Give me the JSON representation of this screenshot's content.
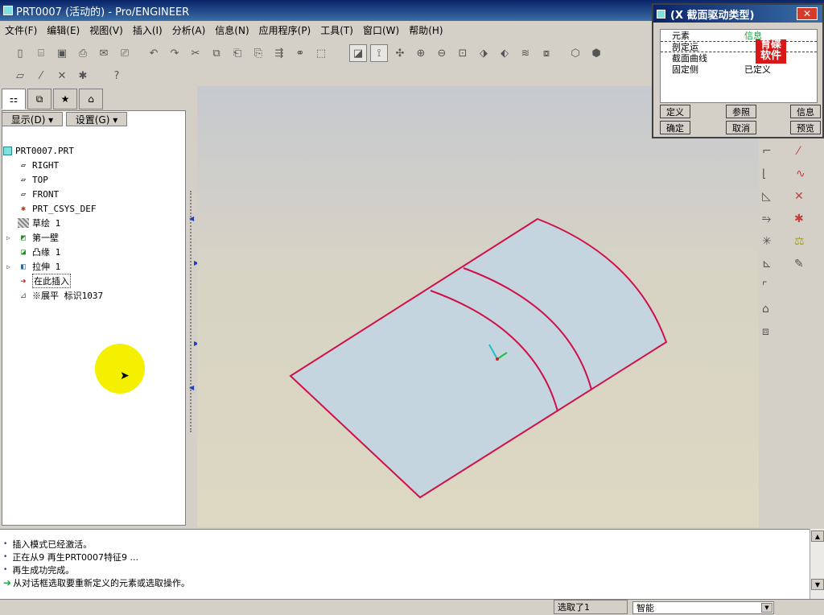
{
  "window": {
    "title": "PRT0007 (活动的) - Pro/ENGINEER"
  },
  "menu": [
    "文件(F)",
    "编辑(E)",
    "视图(V)",
    "插入(I)",
    "分析(A)",
    "信息(N)",
    "应用程序(P)",
    "工具(T)",
    "窗口(W)",
    "帮助(H)"
  ],
  "panel": {
    "show_label": "显示(D) ▾",
    "settings_label": "设置(G) ▾"
  },
  "tree": {
    "items": [
      {
        "label": "PRT0007.PRT",
        "icon": "part-icon"
      },
      {
        "label": "RIGHT",
        "icon": "datum-plane-icon"
      },
      {
        "label": "TOP",
        "icon": "datum-plane-icon"
      },
      {
        "label": "FRONT",
        "icon": "datum-plane-icon"
      },
      {
        "label": "PRT_CSYS_DEF",
        "icon": "csys-icon"
      },
      {
        "label": "草绘 1",
        "icon": "sketch-icon"
      },
      {
        "label": "第一壁",
        "icon": "first-wall-icon"
      },
      {
        "label": "凸缘 1",
        "icon": "flange-icon"
      },
      {
        "label": "拉伸 1",
        "icon": "extrude-icon"
      },
      {
        "label": "在此插入",
        "icon": "insert-here-arrow-icon"
      },
      {
        "label": "※展平 标识1037",
        "icon": "unbend-icon"
      }
    ]
  },
  "dialog": {
    "title": "(X 截面驱动类型)",
    "close": "✕",
    "rows": [
      {
        "col1": "元素",
        "col2": "信息"
      },
      {
        "col1": "剖定运",
        "col2": ""
      },
      {
        "col1": "截面曲线",
        "col2": ""
      },
      {
        "col1": "固定侧",
        "col2": "已定义"
      }
    ],
    "watermark": "育碟软件",
    "buttons": {
      "define": "定义",
      "refs": "参照",
      "info": "信息",
      "ok": "确定",
      "cancel": "取消",
      "preview": "预览"
    }
  },
  "messages": [
    {
      "bullet": "•",
      "text": "插入模式已经激活。"
    },
    {
      "bullet": "•",
      "text": "正在从9 再生PRT0007特征9 ..."
    },
    {
      "bullet": "•",
      "text": "再生成功完成。"
    },
    {
      "bullet": "➔",
      "text": "从对话框选取要重新定义的元素或选取操作。"
    }
  ],
  "status": {
    "selected": "选取了1",
    "filter": "智能"
  },
  "colors": {
    "model_fill": "#c4d5df",
    "model_edge": "#d0104a",
    "title_bar": "#0a246a",
    "cursor_highlight": "#f4f000"
  }
}
